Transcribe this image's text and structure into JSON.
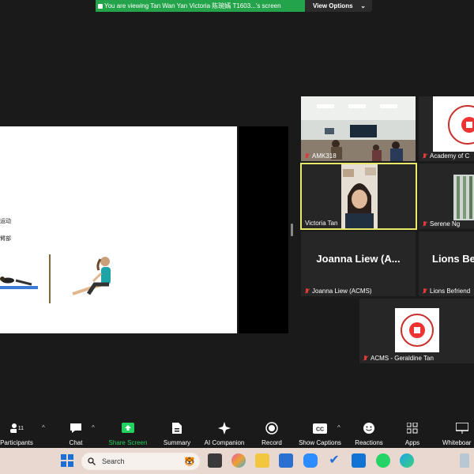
{
  "banner": {
    "text": "You are viewing Tan Wan Yan Victoria 陈琬嫣 T1603...'s screen",
    "view_options": "View Options"
  },
  "slide": {
    "line1": "运动",
    "line2": "臂部"
  },
  "participants": [
    {
      "name": "AMK318"
    },
    {
      "name": "Academy of C"
    },
    {
      "name": "Victoria Tan"
    },
    {
      "name": "Serene Ng"
    },
    {
      "name": "Joanna Liew (ACMS)",
      "display": "Joanna Liew (A..."
    },
    {
      "name": "Lions Befriend",
      "display": "Lions Be"
    },
    {
      "name": "ACMS - Geraldine Tan"
    }
  ],
  "toolbar": {
    "participants": {
      "label": "Participants",
      "count": "11"
    },
    "chat": "Chat",
    "share": "Share Screen",
    "summary": "Summary",
    "ai": "AI Companion",
    "record": "Record",
    "captions": "Show Captions",
    "reactions": "Reactions",
    "apps": "Apps",
    "whiteboard": "Whiteboar"
  },
  "taskbar": {
    "search_placeholder": "Search"
  },
  "colors": {
    "banner_green": "#23a34a",
    "active_speaker": "#e8e86a",
    "share_green": "#23d160"
  }
}
